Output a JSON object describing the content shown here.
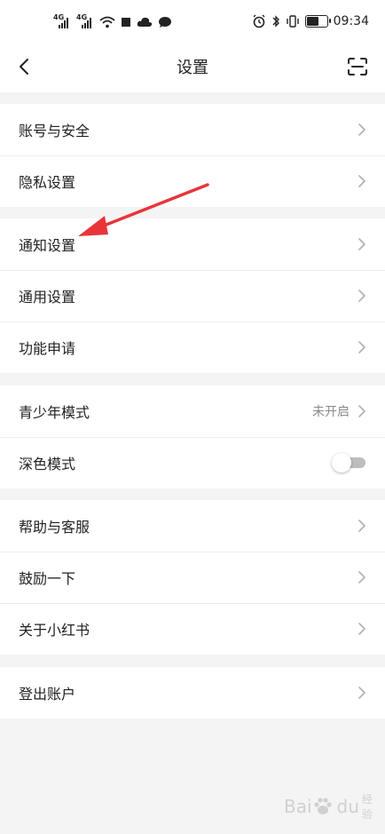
{
  "status_bar": {
    "network_1": "4G",
    "network_2": "4G",
    "time": "09:34"
  },
  "header": {
    "title": "设置"
  },
  "groups": [
    {
      "items": [
        {
          "label": "账号与安全"
        },
        {
          "label": "隐私设置"
        }
      ]
    },
    {
      "items": [
        {
          "label": "通知设置"
        },
        {
          "label": "通用设置"
        },
        {
          "label": "功能申请"
        }
      ]
    },
    {
      "items": [
        {
          "label": "青少年模式",
          "value": "未开启"
        },
        {
          "label": "深色模式",
          "toggle": false
        }
      ]
    },
    {
      "items": [
        {
          "label": "帮助与客服"
        },
        {
          "label": "鼓励一下"
        },
        {
          "label": "关于小红书"
        }
      ]
    },
    {
      "items": [
        {
          "label": "登出账户"
        }
      ]
    }
  ],
  "watermark": {
    "text": "Bai",
    "text2": "du",
    "sub": "经验"
  },
  "colors": {
    "background": "#f4f4f4",
    "card": "#ffffff",
    "divider": "#ececec",
    "text": "#222222",
    "secondary_text": "#8a8a8a",
    "chevron": "#b0b0b0",
    "annotation_arrow": "#e8353a"
  },
  "icons": {
    "back": "chevron-left-icon",
    "scan": "scan-icon",
    "row_chevron": "chevron-right-icon"
  }
}
